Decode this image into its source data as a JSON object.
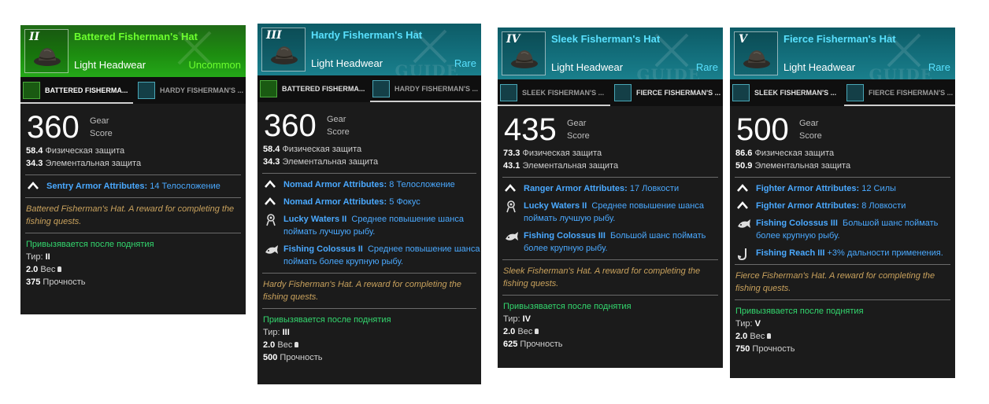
{
  "cards": [
    {
      "roman": "II",
      "name": "Battered Fisherman's Hat",
      "type": "Light Headwear",
      "rarity": "Uncommon",
      "tabs": [
        "BATTERED FISHERMA...",
        "HARDY FISHERMAN'S ..."
      ],
      "gear_score": "360",
      "gear_label_1": "Gear",
      "gear_label_2": "Score",
      "phys_value": "58.4",
      "phys_label": "Физическая защита",
      "elem_value": "34.3",
      "elem_label": "Элементальная защита",
      "attrs": [
        {
          "key": "Sentry Armor Attributes:",
          "value": "14 Телосложение"
        }
      ],
      "perks": [],
      "flavor": "Battered Fisherman's Hat. A reward for completing the fishing quests.",
      "bind": "Привызявается после поднятия",
      "tier_label": "Тир:",
      "tier_value": "II",
      "weight_value": "2.0",
      "weight_label": "Вес",
      "durability_value": "375",
      "durability_label": "Прочность"
    },
    {
      "roman": "III",
      "name": "Hardy Fisherman's Hat",
      "type": "Light Headwear",
      "rarity": "Rare",
      "tabs": [
        "BATTERED FISHERMA...",
        "HARDY FISHERMAN'S ..."
      ],
      "gear_score": "360",
      "gear_label_1": "Gear",
      "gear_label_2": "Score",
      "phys_value": "58.4",
      "phys_label": "Физическая защита",
      "elem_value": "34.3",
      "elem_label": "Элементальная защита",
      "attrs": [
        {
          "key": "Nomad Armor Attributes:",
          "value": "8 Телосложение"
        },
        {
          "key": "Nomad Armor Attributes:",
          "value": "5 Фокус"
        }
      ],
      "perks": [
        {
          "icon": "clover-icon",
          "key": "Lucky Waters II",
          "value": "Среднее повышение шанса поймать лучшую рыбу."
        },
        {
          "icon": "fish-icon",
          "key": "Fishing Colossus II",
          "value": "Среднее повышение шанса поймать более крупную рыбу."
        }
      ],
      "flavor": "Hardy Fisherman's Hat. A reward for completing the fishing quests.",
      "bind": "Привызявается после поднятия",
      "tier_label": "Тир:",
      "tier_value": "III",
      "weight_value": "2.0",
      "weight_label": "Вес",
      "durability_value": "500",
      "durability_label": "Прочность"
    },
    {
      "roman": "IV",
      "name": "Sleek Fisherman's Hat",
      "type": "Light Headwear",
      "rarity": "Rare",
      "tabs": [
        "SLEEK FISHERMAN'S ...",
        "FIERCE FISHERMAN'S ..."
      ],
      "gear_score": "435",
      "gear_label_1": "Gear",
      "gear_label_2": "Score",
      "phys_value": "73.3",
      "phys_label": "Физическая защита",
      "elem_value": "43.1",
      "elem_label": "Элементальная защита",
      "attrs": [
        {
          "key": "Ranger Armor Attributes:",
          "value": "17 Ловкости"
        }
      ],
      "perks": [
        {
          "icon": "clover-icon",
          "key": "Lucky Waters II",
          "value": "Среднее повышение шанса поймать лучшую рыбу."
        },
        {
          "icon": "fish-icon",
          "key": "Fishing Colossus III",
          "value": "Большой шанс поймать более крупную рыбу."
        }
      ],
      "flavor": "Sleek Fisherman's Hat. A reward for completing the fishing quests.",
      "bind": "Привызявается после поднятия",
      "tier_label": "Тир:",
      "tier_value": "IV",
      "weight_value": "2.0",
      "weight_label": "Вес",
      "durability_value": "625",
      "durability_label": "Прочность"
    },
    {
      "roman": "V",
      "name": "Fierce Fisherman's Hat",
      "type": "Light Headwear",
      "rarity": "Rare",
      "tabs": [
        "SLEEK FISHERMAN'S ...",
        "FIERCE FISHERMAN'S ..."
      ],
      "gear_score": "500",
      "gear_label_1": "Gear",
      "gear_label_2": "Score",
      "phys_value": "86.6",
      "phys_label": "Физическая защита",
      "elem_value": "50.9",
      "elem_label": "Элементальная защита",
      "attrs": [
        {
          "key": "Fighter Armor Attributes:",
          "value": "12 Силы"
        },
        {
          "key": "Fighter Armor Attributes:",
          "value": "8 Ловкости"
        }
      ],
      "perks": [
        {
          "icon": "fish-icon",
          "key": "Fishing Colossus III",
          "value": "Большой шанс поймать более крупную рыбу."
        },
        {
          "icon": "hook-icon",
          "key": "Fishing Reach III",
          "value": "+3% дальности применения."
        }
      ],
      "flavor": "Fierce Fisherman's Hat. A reward for completing the fishing quests.",
      "bind": "Привызявается после поднятия",
      "tier_label": "Тир:",
      "tier_value": "V",
      "weight_value": "2.0",
      "weight_label": "Вес",
      "durability_value": "750",
      "durability_label": "Прочность"
    }
  ],
  "watermark": "GUIDE",
  "colors": {
    "uncommon": "#6cff2e",
    "rare": "#59e1ff",
    "attribute_blue": "#4aa9ff",
    "flavor_gold": "#c9a25d",
    "bind_green": "#33d76e",
    "card_bg": "#1b1b1b"
  }
}
